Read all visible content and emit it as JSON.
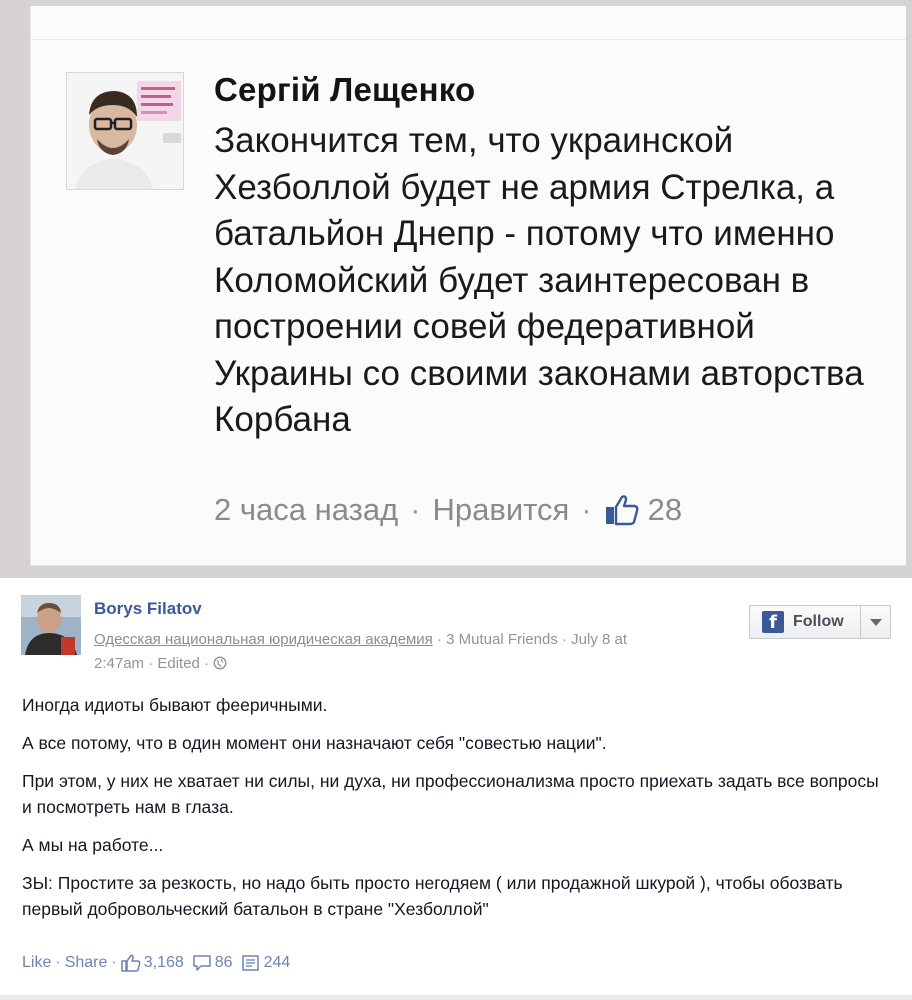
{
  "quote_post": {
    "author": "Сергій Лещенко",
    "text": "Закончится тем, что украинской Хезболлой будет не армия Стрелка, а батальйон Днепр - потому что именно Коломойский будет заинтересован в построении совей федеративной Украины со своими законами авторства Корбана",
    "time": "2 часа назад",
    "like_label": "Нравится",
    "like_count": "28",
    "separator": "·",
    "colors": {
      "name": "#141414",
      "meta": "#8a8a8a",
      "thumb": "#3b5998"
    }
  },
  "fb_post": {
    "author": "Borys Filatov",
    "school": "Одесская национальная юридическая академия",
    "mutual": "· 3 Mutual Friends · July 8 at",
    "time_line": "2:47am · Edited ·",
    "follow_label": "Follow",
    "follow_icon": "f",
    "paragraphs": [
      "Иногда идиоты бывают фееричными.",
      "А все потому, что в один момент они назначают себя \"совестью нации\".",
      "При этом, у них не хватает ни силы, ни духа, ни профессионализма просто приехать задать все вопросы и посмотреть нам в глаза.",
      "А мы на работе...",
      "ЗЫ: Простите за резкость, но надо быть просто негодяем ( или продажной шкурой ), чтобы обозвать первый добровольческий батальон в стране \"Хезболлой\""
    ],
    "actions": {
      "like": "Like",
      "share": "Share",
      "dot": "·",
      "likes_count": "3,168",
      "comments_count": "86",
      "shares_count": "244"
    },
    "colors": {
      "link": "#3b5998",
      "meta": "#90949c",
      "text": "#141823"
    }
  }
}
